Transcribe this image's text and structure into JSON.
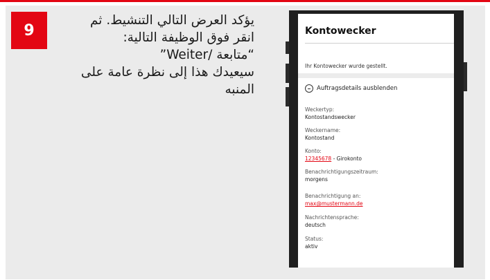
{
  "step": {
    "number": "9"
  },
  "instructions": {
    "lines": [
      "يؤكد العرض التالي التنشيط. ثم",
      "انقر فوق الوظيفة التالية:",
      "“متابعة /Weiter”",
      "سيعيدك هذا إلى نظرة عامة على",
      "المنبه"
    ]
  },
  "app": {
    "title": "Kontowecker",
    "confirmation": "Ihr Kontowecker wurde gestellt.",
    "toggle_label": "Auftragsdetails ausblenden",
    "fields": [
      {
        "label": "Weckertyp:",
        "value": "Kontostandswecker"
      },
      {
        "label": "Weckername:",
        "value": "Kontostand"
      },
      {
        "label": "Konto:",
        "link": "12345678",
        "value": " - Girokonto"
      },
      {
        "label": "Benachrichtigungszeitraum:",
        "value": "morgens"
      },
      {
        "label": "Benachrichtigung an:",
        "link": "max@mustermann.de"
      },
      {
        "label": "Nachrichtensprache:",
        "value": "deutsch"
      },
      {
        "label": "Status:",
        "value": "aktiv"
      }
    ]
  },
  "colors": {
    "accent": "#e30613",
    "panel": "#ebebeb",
    "phone": "#1f1f1f"
  }
}
